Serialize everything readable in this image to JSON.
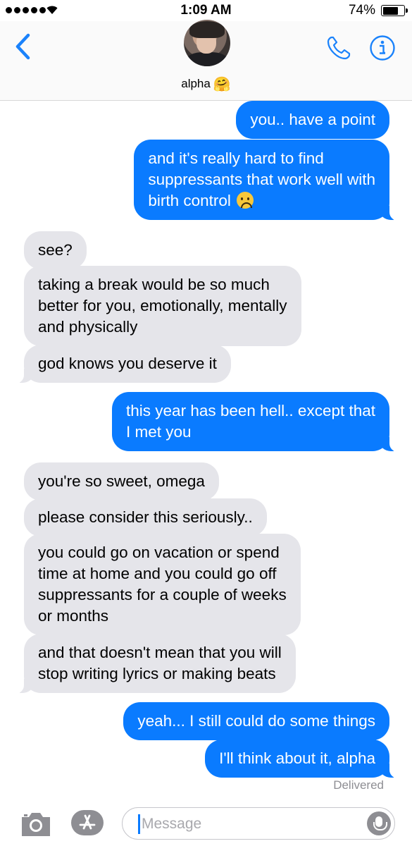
{
  "status_bar": {
    "time": "1:09 AM",
    "battery_percent": "74%",
    "battery_level": 0.74,
    "signal_bars": 5
  },
  "header": {
    "contact_name": "alpha",
    "contact_emoji": "🤗",
    "back_icon": "chevron-left-icon",
    "call_icon": "phone-icon",
    "info_icon": "info-icon"
  },
  "messages": [
    {
      "from": "me",
      "text": "you.. have a point"
    },
    {
      "from": "me",
      "text": "and it's really hard to find\nsuppressants that work well with\nbirth control",
      "emoji": "frowning-face"
    },
    {
      "from": "them",
      "text": "see?"
    },
    {
      "from": "them",
      "text": "taking a break would be so much\nbetter for you, emotionally, mentally\nand physically"
    },
    {
      "from": "them",
      "text": "god knows you deserve it"
    },
    {
      "from": "me",
      "text": "this year has been hell.. except that\nI met you"
    },
    {
      "from": "them",
      "text": "you're so sweet, omega"
    },
    {
      "from": "them",
      "text": "please consider this seriously.."
    },
    {
      "from": "them",
      "text": "you could go on vacation or spend\ntime at home and you could go off\nsuppressants for a couple of weeks\nor months"
    },
    {
      "from": "them",
      "text": "and that doesn't mean that you will\nstop writing lyrics or making beats"
    },
    {
      "from": "me",
      "text": "yeah... I still could do some things"
    },
    {
      "from": "me",
      "text": "I'll think about it, alpha"
    }
  ],
  "delivery_status": "Delivered",
  "input": {
    "placeholder": "Message",
    "value": ""
  },
  "colors": {
    "sent_bubble": "#0a7bff",
    "received_bubble": "#e5e5ea",
    "accent": "#1a82fb"
  }
}
